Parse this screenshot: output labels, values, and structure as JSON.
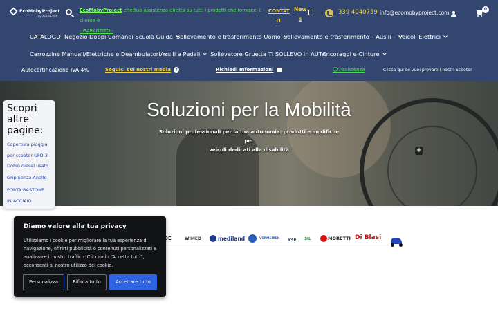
{
  "header": {
    "logo": {
      "name": "EcoMobyProject",
      "tagline": "by Ausiliarsoft"
    },
    "promo": {
      "brand": "EcoMobyProject",
      "text": " effettua assistenza diretta su tutti i prodotti che fornisce, il cliente è ",
      "guarantee": "- GARANTITO -"
    },
    "contatti_line1": "CONTAT",
    "contatti_line2": "TI",
    "news_line1": "New",
    "news_line2": "s",
    "phone": "339 4040759",
    "email": "info@ecomobyproject.com",
    "cart_count": "0"
  },
  "nav": {
    "row1": [
      {
        "label": "CATALOGO",
        "chevron": false
      },
      {
        "label": "Negozio Doppi Comandi Scuola Guida",
        "chevron": true
      },
      {
        "label": "Sollevamento e trasferimento Uomo",
        "chevron": true
      },
      {
        "label": "Sollevamento e trasferimento – Ausili –",
        "chevron": true
      },
      {
        "label": "Veicoli Elettrici",
        "chevron": true
      }
    ],
    "row2": [
      {
        "label": "Carrozzine Manuali/Elettriche e Deambulatori",
        "chevron": true
      },
      {
        "label": "Ausili a Pedali",
        "chevron": true
      },
      {
        "label": "Sollevatore Gruetta TI SOLLEVO in AUTO",
        "chevron": false
      },
      {
        "label": "Ancoraggi e Cinture",
        "chevron": true
      }
    ]
  },
  "info_bar": {
    "iva": "Autocertificazione IVA 4%",
    "media": "Seguici sui nostri media",
    "richiedi": "Richiedi Informazioni",
    "assistenza": "🛈 Assistenza",
    "scooter": "Clicca qui se vuoi provare i nostri Scooter"
  },
  "hero": {
    "title": "Soluzioni per la Mobilità",
    "subtitle_line1": "Soluzioni professionali per la tua autonomia: prodotti e modifiche per",
    "subtitle_line2": "veicoli dedicati alla disabilità"
  },
  "sidebar": {
    "title": "Scopri altre pagine:",
    "links": [
      {
        "line1": "Copertura pioggia",
        "line2": "per scooter UFO 3"
      },
      {
        "line1": "Doblò diesel usato",
        "line2": ""
      },
      {
        "line1": "Grip Senza Anello",
        "line2": ""
      },
      {
        "line1": "PORTA BASTONE",
        "line2": "IN ACCIAIO"
      }
    ]
  },
  "brands": [
    "OE",
    "WIMED",
    "mediland",
    "VERMEIREN",
    "KSP",
    "SIL",
    "MORETTI",
    "Di Blasi"
  ],
  "cookie": {
    "title": "Diamo valore alla tua privacy",
    "text": "Utilizziamo i cookie per migliorare la tua esperienza di navigazione, offrirti pubblicità o contenuti personalizzati e analizzare il nostro traffico. Cliccando “Accetta tutti”, acconsenti al nostro utilizzo dei cookie.",
    "customize": "Personalizza",
    "reject": "Rifiuta tutto",
    "accept": "Accettare tutto"
  },
  "colors": {
    "header_bg": "#33466f",
    "accent_yellow": "#f2d13a",
    "accent_green": "#4ee04e",
    "cookie_bg": "#121317",
    "button_blue": "#2e63e3"
  }
}
